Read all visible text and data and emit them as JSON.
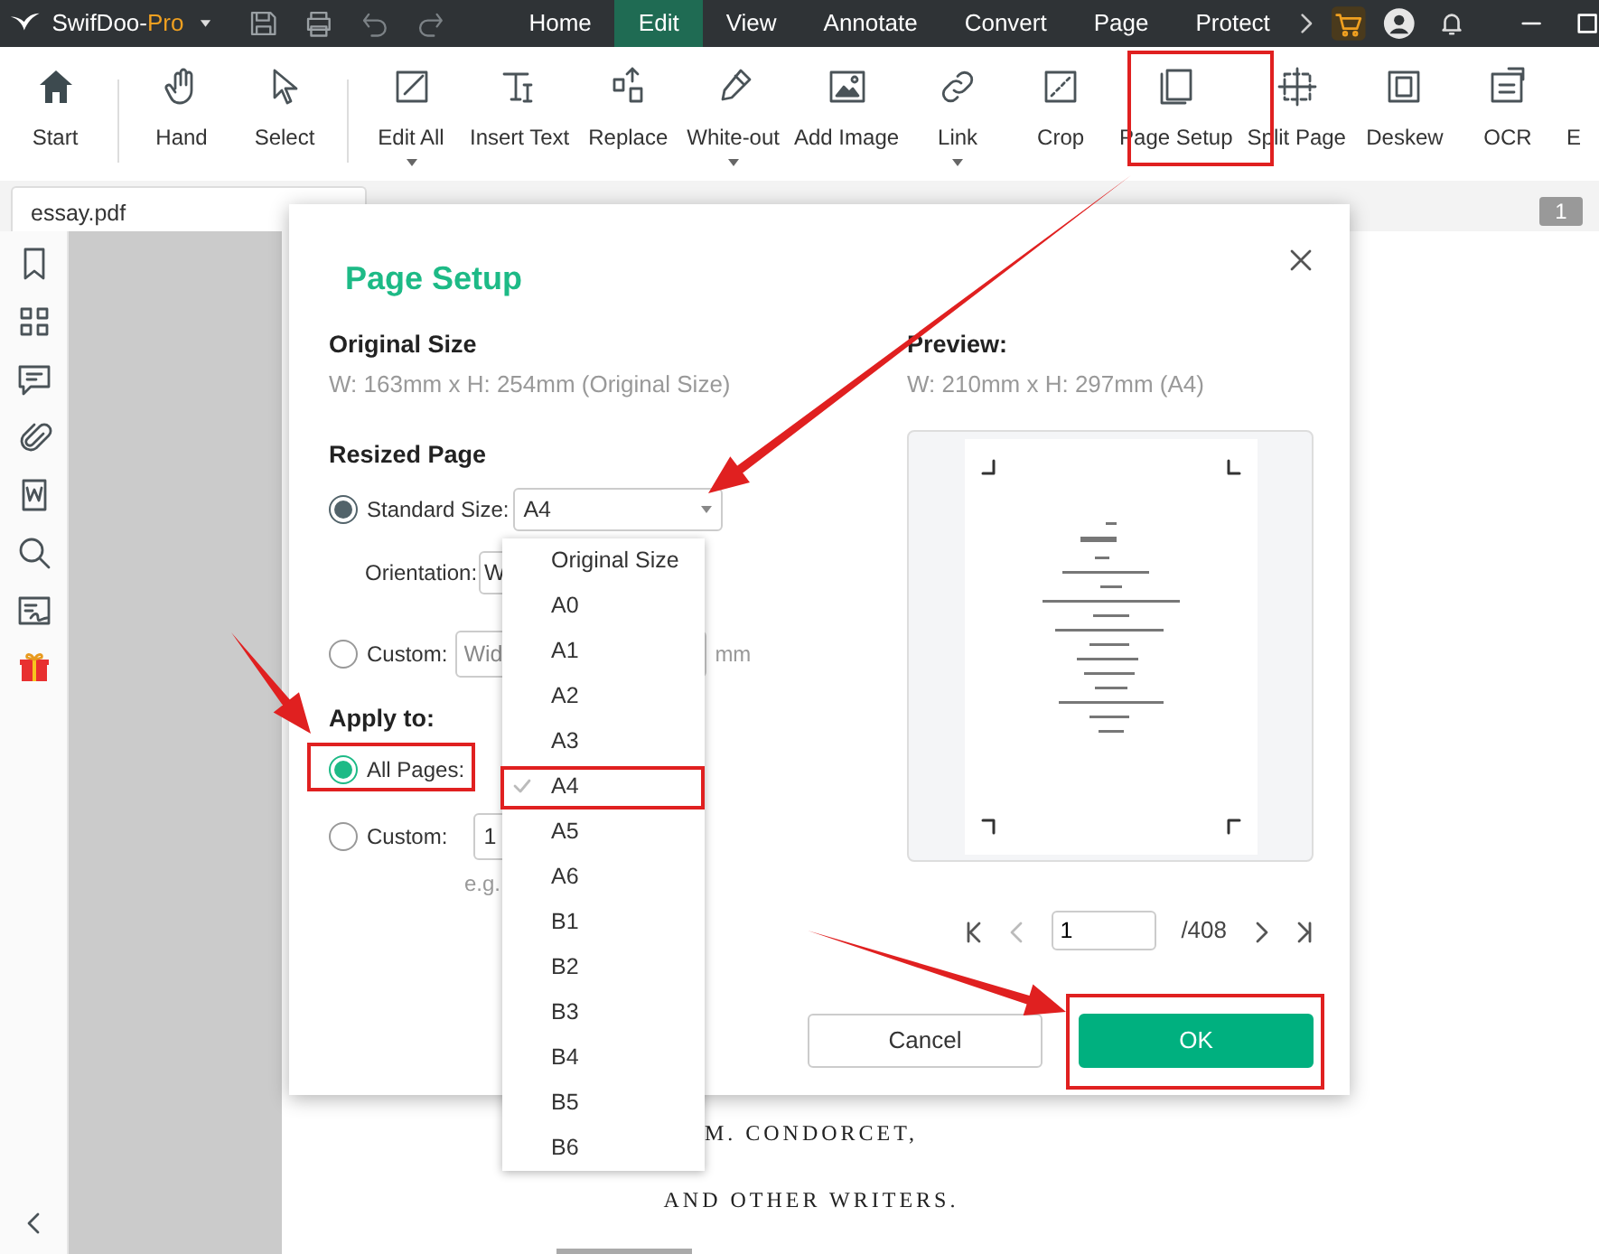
{
  "title_bar": {
    "brand": "SwifDoo-",
    "brand_suffix": "Pro",
    "menu_tabs": [
      {
        "label": "Home",
        "selected": false
      },
      {
        "label": "Edit",
        "selected": true
      },
      {
        "label": "View",
        "selected": false
      },
      {
        "label": "Annotate",
        "selected": false
      },
      {
        "label": "Convert",
        "selected": false
      },
      {
        "label": "Page",
        "selected": false
      },
      {
        "label": "Protect",
        "selected": false
      }
    ]
  },
  "toolbar": {
    "groups": [
      [
        {
          "label": "Start",
          "has_menu": false
        }
      ],
      [
        {
          "label": "Hand",
          "has_menu": false
        },
        {
          "label": "Select",
          "has_menu": false
        }
      ],
      [
        {
          "label": "Edit All",
          "has_menu": true
        },
        {
          "label": "Insert Text",
          "has_menu": false
        },
        {
          "label": "Replace",
          "has_menu": false
        },
        {
          "label": "White-out",
          "has_menu": true
        },
        {
          "label": "Add Image",
          "has_menu": false
        },
        {
          "label": "Link",
          "has_menu": true
        },
        {
          "label": "Crop",
          "has_menu": false
        },
        {
          "label": "Page Setup",
          "has_menu": false
        },
        {
          "label": "Split Page",
          "has_menu": false
        },
        {
          "label": "Deskew",
          "has_menu": false
        },
        {
          "label": "OCR",
          "has_menu": false
        },
        {
          "label": "E",
          "has_menu": false
        }
      ]
    ]
  },
  "document_tab": "essay.pdf",
  "page_badge": "1",
  "document_lines": [
    "M. CONDORCET,",
    "AND OTHER WRITERS."
  ],
  "dialog": {
    "title": "Page Setup",
    "original_size": {
      "label": "Original Size",
      "value": "W: 163mm x H: 254mm (Original Size)"
    },
    "resized_page": {
      "label": "Resized Page",
      "options": [
        {
          "kind": "standard",
          "label": "Standard Size:",
          "selected": true,
          "value": "A4"
        },
        {
          "kind": "custom",
          "label": "Custom:",
          "selected": false,
          "placeholder": "Wid",
          "unit": "mm"
        }
      ],
      "orientation": {
        "label": "Orientation:",
        "value": "W"
      }
    },
    "apply_to": {
      "label": "Apply to:",
      "options": [
        {
          "kind": "all",
          "label": "All Pages:",
          "selected": true
        },
        {
          "kind": "custom",
          "label": "Custom:",
          "selected": false,
          "value": "1",
          "hint": "e.g."
        }
      ]
    },
    "preview": {
      "label": "Preview:",
      "value": "W: 210mm x H: 297mm (A4)",
      "page_input": "1",
      "page_total": "/408"
    },
    "buttons": [
      {
        "label": "Cancel",
        "kind": "secondary"
      },
      {
        "label": "OK",
        "kind": "primary"
      }
    ]
  },
  "size_menu": {
    "items": [
      {
        "label": "Original Size",
        "selected": false
      },
      {
        "label": "A0",
        "selected": false
      },
      {
        "label": "A1",
        "selected": false
      },
      {
        "label": "A2",
        "selected": false
      },
      {
        "label": "A3",
        "selected": false
      },
      {
        "label": "A4",
        "selected": true
      },
      {
        "label": "A5",
        "selected": false
      },
      {
        "label": "A6",
        "selected": false
      },
      {
        "label": "B1",
        "selected": false
      },
      {
        "label": "B2",
        "selected": false
      },
      {
        "label": "B3",
        "selected": false
      },
      {
        "label": "B4",
        "selected": false
      },
      {
        "label": "B5",
        "selected": false
      },
      {
        "label": "B6",
        "selected": false
      }
    ]
  }
}
